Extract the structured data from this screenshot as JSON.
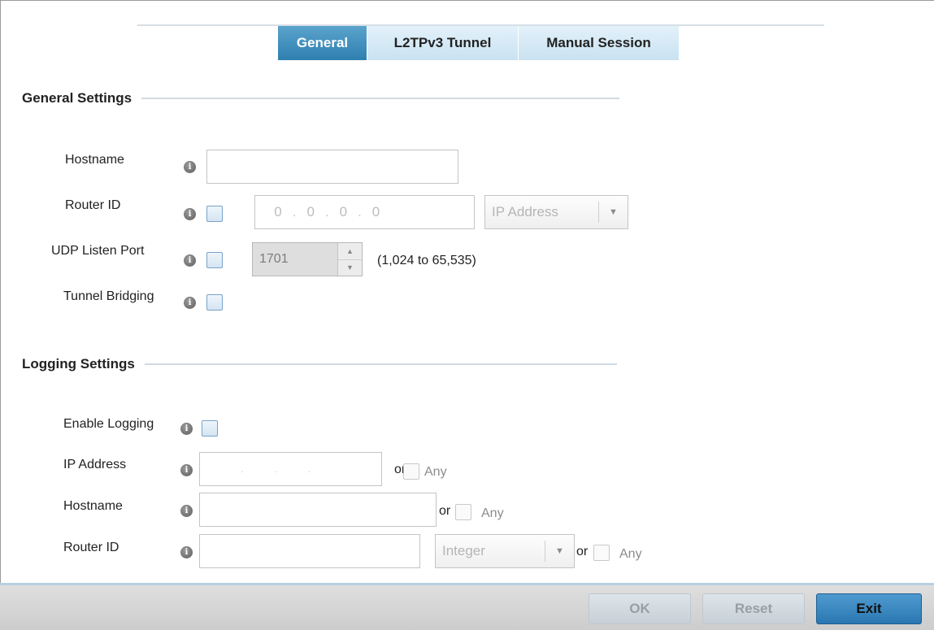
{
  "tabs": [
    {
      "label": "General",
      "active": true
    },
    {
      "label": "L2TPv3 Tunnel",
      "active": false
    },
    {
      "label": "Manual Session",
      "active": false
    }
  ],
  "general_settings": {
    "title": "General Settings",
    "hostname_label": "Hostname",
    "hostname_value": "",
    "router_id_label": "Router ID",
    "router_id_ip": [
      "0",
      "0",
      "0",
      "0"
    ],
    "router_id_type": "IP Address",
    "udp_listen_port_label": "UDP Listen Port",
    "udp_listen_port_value": "1701",
    "udp_range_hint": "(1,024 to 65,535)",
    "tunnel_bridging_label": "Tunnel Bridging"
  },
  "logging_settings": {
    "title": "Logging Settings",
    "enable_logging_label": "Enable Logging",
    "ip_address_label": "IP Address",
    "hostname_label": "Hostname",
    "router_id_label": "Router ID",
    "router_id_type": "Integer",
    "or_text": "or",
    "any_text": "Any"
  },
  "footer": {
    "ok_label": "OK",
    "reset_label": "Reset",
    "exit_label": "Exit"
  },
  "colors": {
    "tab_active": "#2e7fb0",
    "tab_inactive": "#c9e2f1",
    "exit_button": "#2a76b1",
    "footer_bg": "#d6d6d6"
  },
  "icons": {
    "info": "info-icon",
    "dropdown": "chevron-down-icon",
    "spin_up": "spin-up-icon",
    "spin_down": "spin-down-icon"
  }
}
